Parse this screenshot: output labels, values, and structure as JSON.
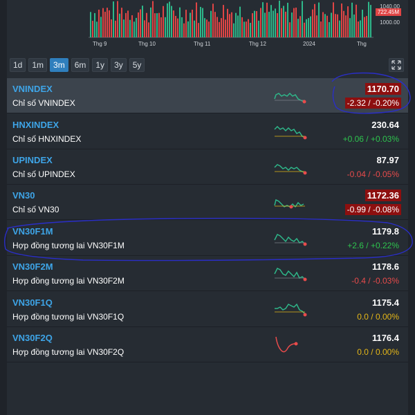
{
  "chart": {
    "price_levels": [
      "1040.00",
      "1000.00"
    ],
    "current_tag": "722.45M",
    "x_labels": [
      "Thg 9",
      "Thg 10",
      "Thg 11",
      "Thg 12",
      "2024",
      "Thg"
    ],
    "colors": {
      "up": "#2eb88a",
      "down": "#e04545"
    }
  },
  "ranges": {
    "buttons": [
      "1d",
      "1m",
      "3m",
      "6m",
      "1y",
      "3y",
      "5y"
    ],
    "active": "3m"
  },
  "rows": [
    {
      "symbol": "VNINDEX",
      "name": "Chỉ số VNINDEX",
      "price": "1170.70",
      "change": "-2.32 / -0.20%",
      "trend": "down"
    },
    {
      "symbol": "HNXINDEX",
      "name": "Chỉ số HNXINDEX",
      "price": "230.64",
      "change": "+0.06 / +0.03%",
      "trend": "up"
    },
    {
      "symbol": "UPINDEX",
      "name": "Chỉ số UPINDEX",
      "price": "87.97",
      "change": "-0.04 / -0.05%",
      "trend": "down"
    },
    {
      "symbol": "VN30",
      "name": "Chỉ số VN30",
      "price": "1172.36",
      "change": "-0.99 / -0.08%",
      "trend": "down"
    },
    {
      "symbol": "VN30F1M",
      "name": "Hợp đồng tương lai VN30F1M",
      "price": "1179.8",
      "change": "+2.6 / +0.22%",
      "trend": "up"
    },
    {
      "symbol": "VN30F2M",
      "name": "Hợp đồng tương lai VN30F2M",
      "price": "1178.6",
      "change": "-0.4 / -0.03%",
      "trend": "down"
    },
    {
      "symbol": "VN30F1Q",
      "name": "Hợp đồng tương lai VN30F1Q",
      "price": "1175.4",
      "change": "0.0 / 0.00%",
      "trend": "flat"
    },
    {
      "symbol": "VN30F2Q",
      "name": "Hợp đồng tương lai VN30F2Q",
      "price": "1176.4",
      "change": "0.0 / 0.00%",
      "trend": "flat"
    }
  ]
}
